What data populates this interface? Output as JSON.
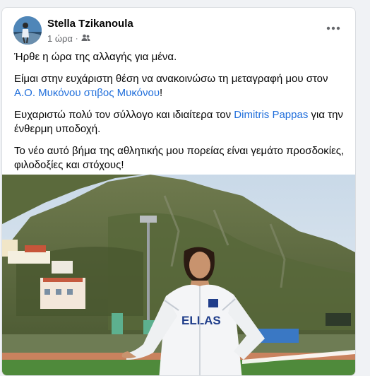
{
  "post": {
    "author": "Stella Tzikanoula",
    "time": "1 ώρα",
    "dot": "·",
    "audience_icon": "friends-icon",
    "more_icon": "more-options-icon",
    "paragraph1": "Ήρθε η ώρα της αλλαγής για μένα.",
    "paragraph2_before": "Είμαι στην ευχάριστη θέση να ανακοινώσω τη μεταγραφή μου στον ",
    "paragraph2_link": "Α.Ο. Μυκόνου στιβος Μυκόνου",
    "paragraph2_after": "!",
    "paragraph3_before": "Ευχαριστώ πολύ τον σύλλογο και ιδιαίτερα τον ",
    "paragraph3_link": "Dimitris Pappas",
    "paragraph3_after": " για την ένθερμη υποδοχή.",
    "paragraph4": "Το νέο αυτό βήμα της αθλητικής μου πορείας είναι γεμάτο προσδοκίες, φιλοδοξίες και στόχους!",
    "photo_jacket_text": "ELLAS"
  },
  "colors": {
    "link": "#216fdb",
    "text": "#050505",
    "secondary": "#65676b"
  }
}
